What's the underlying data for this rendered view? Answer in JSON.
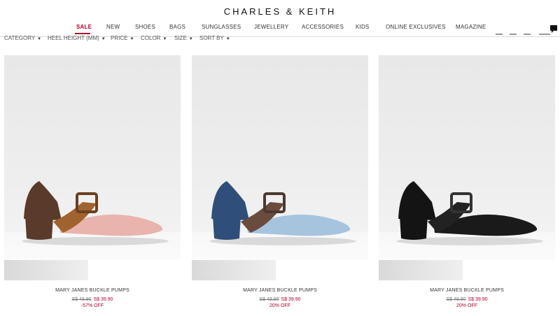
{
  "brand": {
    "name": "CHARLES & KEITH"
  },
  "nav": {
    "items": [
      "SALE",
      "NEW",
      "SHOES",
      "BAGS",
      "SUNGLASSES",
      "JEWELLERY",
      "ACCESSORIES",
      "KIDS",
      "ONLINE EXCLUSIVES",
      "MAGAZINE"
    ],
    "active": "SALE"
  },
  "filters": {
    "items": [
      "CATEGORY",
      "HEEL HEIGHT (MM)",
      "PRICE",
      "COLOR",
      "SIZE",
      "SORT BY"
    ]
  },
  "colors": {
    "accent": "#b1002a"
  },
  "products": [
    {
      "name": "MARY JANES BUCKLE PUMPS",
      "old_price": "S$ 49.90",
      "new_price": "S$ 39.90",
      "discount": "-57% OFF",
      "colors": {
        "main": "#e8b4ad",
        "heel": "#5a3a2a",
        "strap": "#a0622f",
        "buckle": "#6b4120"
      }
    },
    {
      "name": "MARY JANES BUCKLE PUMPS",
      "old_price": "S$ 49.90",
      "new_price": "S$ 39.90",
      "discount": "20% OFF",
      "colors": {
        "main": "#a6c4de",
        "heel": "#2f4f7a",
        "strap": "#6a4b3d",
        "buckle": "#4b3a30"
      }
    },
    {
      "name": "MARY JANES BUCKLE PUMPS",
      "old_price": "S$ 49.90",
      "new_price": "S$ 39.90",
      "discount": "20% OFF",
      "colors": {
        "main": "#1a1a1a",
        "heel": "#141414",
        "strap": "#222222",
        "buckle": "#333333"
      }
    }
  ]
}
